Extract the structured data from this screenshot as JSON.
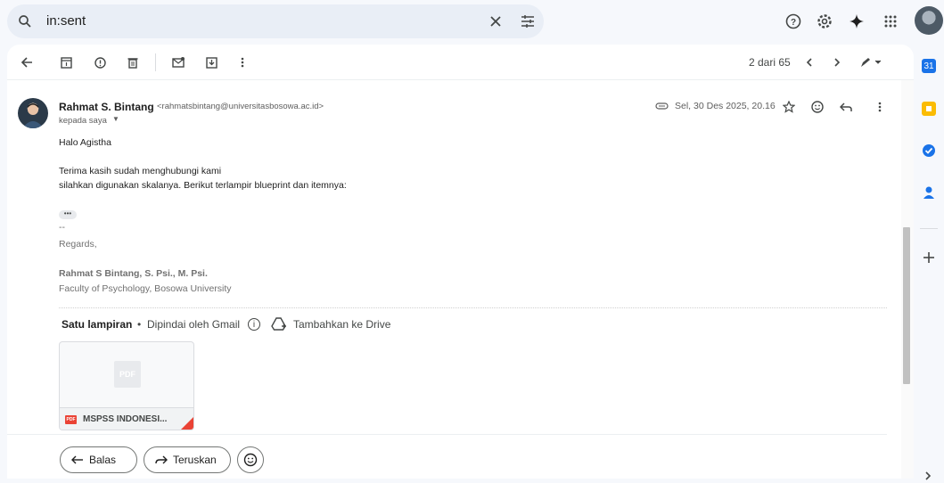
{
  "search": {
    "query": "in:sent"
  },
  "toolbar": {
    "page_count": "2 dari 65"
  },
  "email": {
    "sender_name": "Rahmat S. Bintang",
    "sender_email": "<rahmatsbintang@universitasbosowa.ac.id>",
    "recipient": "kepada saya",
    "date": "Sel, 30 Des 2025, 20.16",
    "body": [
      "Halo Agistha",
      "Terima kasih sudah menghubungi kami",
      "silahkan digunakan skalanya. Berikut terlampir blueprint dan itemnya:"
    ],
    "trimmed": "•••",
    "signature": {
      "dash": "--",
      "regards": "Regards,",
      "name": "Rahmat S Bintang, S. Psi., M. Psi.",
      "affiliation": "Faculty of Psychology, Bosowa University"
    }
  },
  "attachments": {
    "title": "Satu lampiran",
    "separator": "•",
    "scanned": "Dipindai oleh Gmail",
    "add_to_drive": "Tambahkan ke Drive",
    "file": {
      "thumb_label": "PDF",
      "badge": "PDF",
      "name": "MSPSS INDONESI..."
    }
  },
  "actions": {
    "reply": "Balas",
    "forward": "Teruskan"
  },
  "colors": {
    "accent": "#0b57d0",
    "pdf_red": "#ea4335",
    "background": "#f6f8fc"
  }
}
